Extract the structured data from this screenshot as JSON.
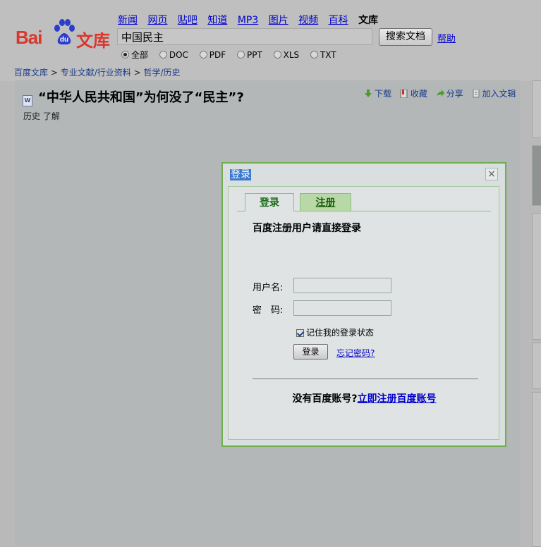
{
  "logo": {
    "bai": "Bai",
    "du": "du",
    "wenku": "文库"
  },
  "nav": [
    "新闻",
    "网页",
    "贴吧",
    "知道",
    "MP3",
    "图片",
    "视频",
    "百科"
  ],
  "nav_current": "文库",
  "search": {
    "value": "中国民主",
    "button": "搜索文档",
    "help": "帮助"
  },
  "filters": [
    {
      "label": "全部",
      "selected": true
    },
    {
      "label": "DOC",
      "selected": false
    },
    {
      "label": "PDF",
      "selected": false
    },
    {
      "label": "PPT",
      "selected": false
    },
    {
      "label": "XLS",
      "selected": false
    },
    {
      "label": "TXT",
      "selected": false
    }
  ],
  "breadcrumb": {
    "home": "百度文库",
    "cat": "专业文献/行业资料",
    "sub": "哲学/历史",
    "sep": " > "
  },
  "document": {
    "icon": "W",
    "title": "“中华人民共和国”为何没了“民主”?",
    "tags": "历史 了解"
  },
  "actions": {
    "download": "下载",
    "favorite": "收藏",
    "share": "分享",
    "add": "加入文辑"
  },
  "dialog": {
    "title": "登录",
    "close": "×",
    "tab_login": "登录",
    "tab_register": "注册",
    "heading": "百度注册用户请直接登录",
    "username_label": "用户名:",
    "password_label": "密　码:",
    "username_value": "",
    "password_value": "",
    "remember": "记住我的登录状态",
    "remember_checked": true,
    "login_button": "登录",
    "forgot": "忘记密码?",
    "no_account": "没有百度账号?",
    "register_link": "立即注册百度账号"
  },
  "colors": {
    "logo_red": "#d9362c",
    "paw_blue": "#2b3ccf",
    "dialog_border": "#6fae4f",
    "link": "#0000cc"
  }
}
